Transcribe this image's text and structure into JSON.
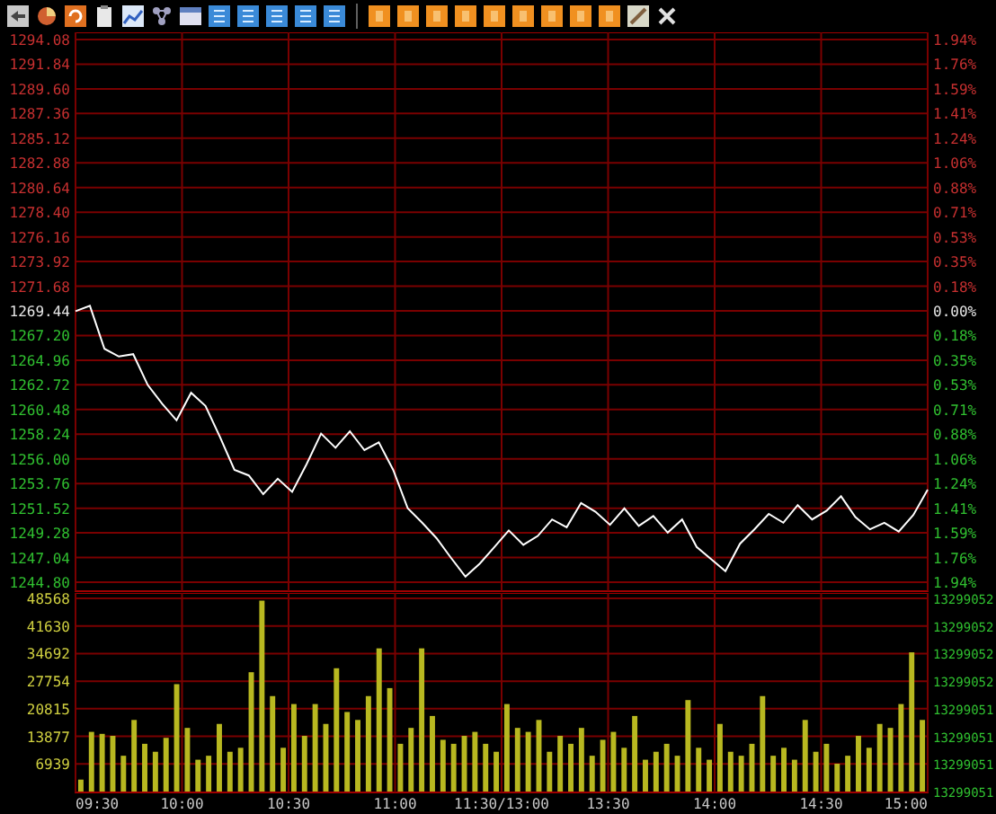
{
  "price_panel": {
    "right_labels": [
      {
        "label": "1.94%",
        "color": "#c83030"
      },
      {
        "label": "1.76%",
        "color": "#c83030"
      },
      {
        "label": "1.59%",
        "color": "#c83030"
      },
      {
        "label": "1.41%",
        "color": "#c83030"
      },
      {
        "label": "1.24%",
        "color": "#c83030"
      },
      {
        "label": "1.06%",
        "color": "#c83030"
      },
      {
        "label": "0.88%",
        "color": "#c83030"
      },
      {
        "label": "0.71%",
        "color": "#c83030"
      },
      {
        "label": "0.53%",
        "color": "#c83030"
      },
      {
        "label": "0.35%",
        "color": "#c83030"
      },
      {
        "label": "0.18%",
        "color": "#c83030"
      },
      {
        "label": "0.00%",
        "color": "#e8e8e8"
      },
      {
        "label": "0.18%",
        "color": "#30c030"
      },
      {
        "label": "0.35%",
        "color": "#30c030"
      },
      {
        "label": "0.53%",
        "color": "#30c030"
      },
      {
        "label": "0.71%",
        "color": "#30c030"
      },
      {
        "label": "0.88%",
        "color": "#30c030"
      },
      {
        "label": "1.06%",
        "color": "#30c030"
      },
      {
        "label": "1.24%",
        "color": "#30c030"
      },
      {
        "label": "1.41%",
        "color": "#30c030"
      },
      {
        "label": "1.59%",
        "color": "#30c030"
      },
      {
        "label": "1.76%",
        "color": "#30c030"
      },
      {
        "label": "1.94%",
        "color": "#30c030"
      }
    ],
    "chart_data": {
      "type": "line",
      "grid": true,
      "ylim": [
        1244.8,
        1294.08
      ],
      "yticks": [
        {
          "value": 1294.08,
          "label": "1294.08"
        },
        {
          "value": 1291.84,
          "label": "1291.84"
        },
        {
          "value": 1289.6,
          "label": "1289.60"
        },
        {
          "value": 1287.36,
          "label": "1287.36"
        },
        {
          "value": 1285.12,
          "label": "1285.12"
        },
        {
          "value": 1282.88,
          "label": "1282.88"
        },
        {
          "value": 1280.64,
          "label": "1280.64"
        },
        {
          "value": 1278.4,
          "label": "1278.40"
        },
        {
          "value": 1276.16,
          "label": "1276.16"
        },
        {
          "value": 1273.92,
          "label": "1273.92"
        },
        {
          "value": 1271.68,
          "label": "1271.68"
        },
        {
          "value": 1269.44,
          "label": "1269.44"
        },
        {
          "value": 1267.2,
          "label": "1267.20"
        },
        {
          "value": 1264.96,
          "label": "1264.96"
        },
        {
          "value": 1262.72,
          "label": "1262.72"
        },
        {
          "value": 1260.48,
          "label": "1260.48"
        },
        {
          "value": 1258.24,
          "label": "1258.24"
        },
        {
          "value": 1256.0,
          "label": "1256.00"
        },
        {
          "value": 1253.76,
          "label": "1253.76"
        },
        {
          "value": 1251.52,
          "label": "1251.52"
        },
        {
          "value": 1249.28,
          "label": "1249.28"
        },
        {
          "value": 1247.04,
          "label": "1247.04"
        },
        {
          "value": 1244.8,
          "label": "1244.80"
        }
      ],
      "series": [
        {
          "color": "#ffffff",
          "values": [
            1269.4,
            1269.9,
            1266.0,
            1265.3,
            1265.5,
            1262.7,
            1261.0,
            1259.5,
            1262.0,
            1260.8,
            1258.0,
            1255.0,
            1254.5,
            1252.8,
            1254.2,
            1253.0,
            1255.5,
            1258.3,
            1257.0,
            1258.5,
            1256.8,
            1257.5,
            1255.0,
            1251.5,
            1250.2,
            1248.8,
            1247.0,
            1245.3,
            1246.5,
            1248.0,
            1249.5,
            1248.2,
            1249.0,
            1250.5,
            1249.8,
            1252.0,
            1251.2,
            1250.0,
            1251.5,
            1249.9,
            1250.8,
            1249.3,
            1250.5,
            1248.0,
            1246.9,
            1245.8,
            1248.3,
            1249.6,
            1251.0,
            1250.2,
            1251.8,
            1250.5,
            1251.3,
            1252.6,
            1250.7,
            1249.6,
            1250.2,
            1249.4,
            1250.9,
            1253.2
          ]
        }
      ]
    }
  },
  "volume_panel": {
    "right_labels": [
      "13299052",
      "13299052",
      "13299052",
      "13299052",
      "13299051",
      "13299051",
      "13299051",
      "13299051"
    ],
    "time_labels": [
      "09:30",
      "10:00",
      "10:30",
      "11:00",
      "11:30/13:00",
      "13:30",
      "14:00",
      "14:30",
      "15:00"
    ],
    "chart_data": {
      "type": "bar",
      "grid": true,
      "ylim": [
        0,
        48568
      ],
      "yticks": [
        {
          "value": 48568,
          "label": "48568"
        },
        {
          "value": 41630,
          "label": "41630"
        },
        {
          "value": 34692,
          "label": "34692"
        },
        {
          "value": 27754,
          "label": "27754"
        },
        {
          "value": 20815,
          "label": "20815"
        },
        {
          "value": 13877,
          "label": "13877"
        },
        {
          "value": 6939,
          "label": "6939"
        }
      ],
      "series": [
        {
          "color": "#b8b820",
          "values": [
            3000,
            15000,
            14500,
            14000,
            9000,
            18000,
            12000,
            10000,
            13500,
            27000,
            16000,
            8000,
            9000,
            17000,
            10000,
            11000,
            30000,
            48000,
            24000,
            11000,
            22000,
            14000,
            22000,
            17000,
            31000,
            20000,
            18000,
            24000,
            36000,
            26000,
            12000,
            16000,
            36000,
            19000,
            13000,
            12000,
            14000,
            15000,
            12000,
            10000,
            22000,
            16000,
            15000,
            18000,
            10000,
            14000,
            12000,
            16000,
            9000,
            13000,
            15000,
            11000,
            19000,
            8000,
            10000,
            12000,
            9000,
            23000,
            11000,
            8000,
            17000,
            10000,
            9000,
            12000,
            24000,
            9000,
            11000,
            8000,
            18000,
            10000,
            12000,
            7000,
            9000,
            14000,
            11000,
            17000,
            16000,
            22000,
            35000,
            18000
          ]
        }
      ]
    }
  }
}
